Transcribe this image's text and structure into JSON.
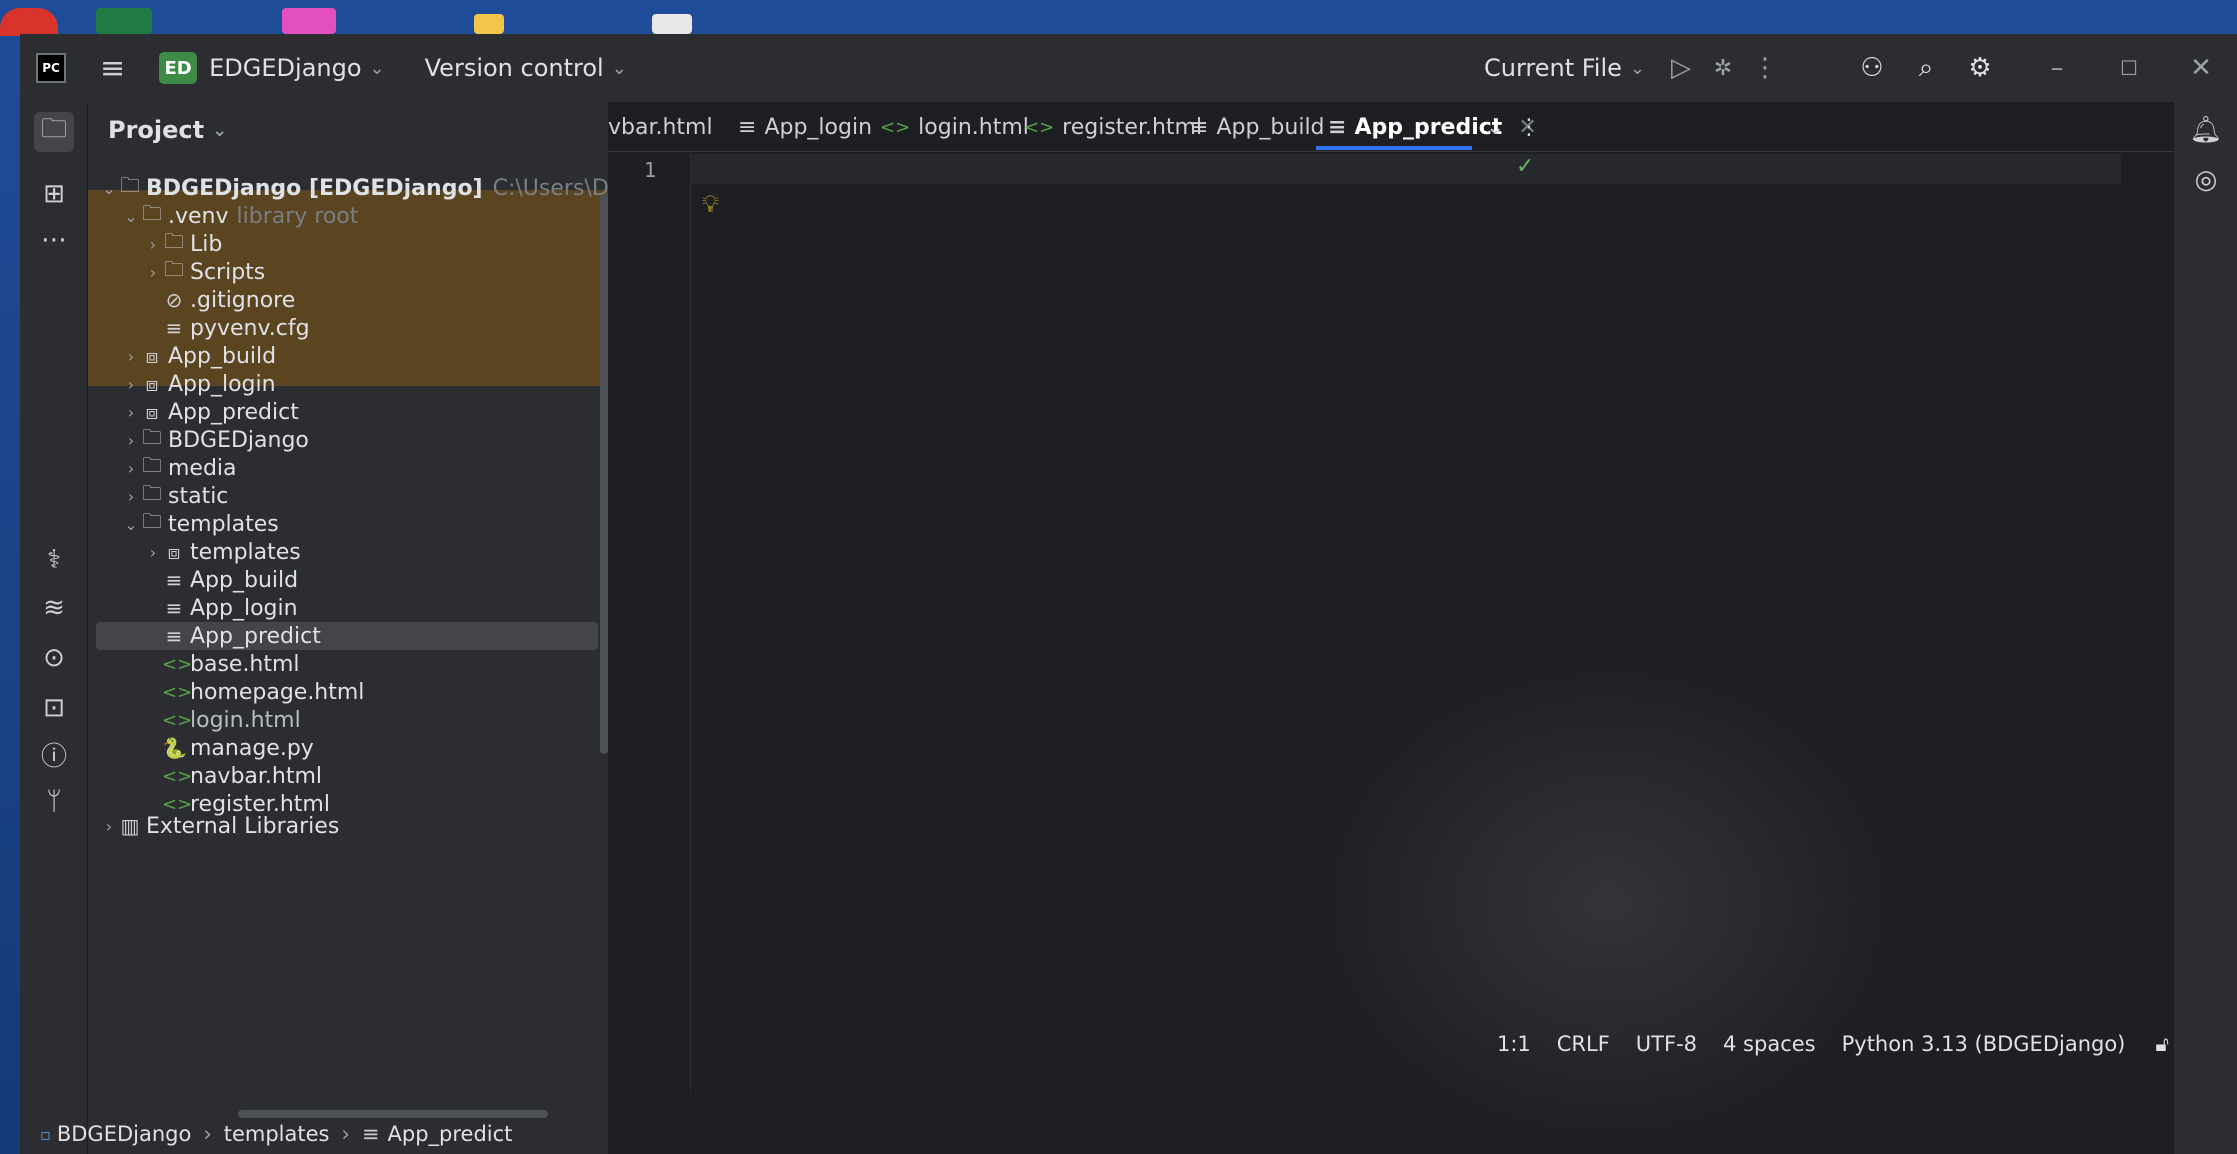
{
  "titlebar": {
    "app_icon": "PC",
    "menu_icon": "hamburger-icon",
    "project_badge": "ED",
    "project_name": "EDGEDjango",
    "vcs": "Version control",
    "run_config": "Current File"
  },
  "toolstrip": {
    "items": [
      "folder-icon",
      "structure-icon",
      "more-icon",
      "python-console-icon",
      "layers-icon",
      "services-icon",
      "terminal-icon",
      "problems-icon",
      "git-icon"
    ]
  },
  "project": {
    "header": "Project",
    "root_name": "BDGEDjango [EDGEDjango]",
    "root_path": "C:\\Users\\Dibakar\\PycharmProject",
    "venv": ".venv",
    "venv_hint": "library root",
    "items": {
      "lib": "Lib",
      "scripts": "Scripts",
      "gitignore": ".gitignore",
      "pyvenv": "pyvenv.cfg",
      "app_build": "App_build",
      "app_login": "App_login",
      "app_predict": "App_predict",
      "bdgedjango": "BDGEDjango",
      "media": "media",
      "static": "static",
      "templates": "templates",
      "templates_sub": "templates",
      "t_app_build": "App_build",
      "t_app_login": "App_login",
      "t_app_predict": "App_predict",
      "base_html": "base.html",
      "homepage_html": "homepage.html",
      "login_html": "login.html",
      "manage_py": "manage.py",
      "navbar_html": "navbar.html",
      "register_html": "register.html",
      "external": "External Libraries"
    }
  },
  "tabs": [
    "vbar.html",
    "App_login",
    "login.html",
    "register.html",
    "App_build",
    "App_predict"
  ],
  "editor": {
    "line1": "1"
  },
  "status": {
    "position": "1:1",
    "line_sep": "CRLF",
    "encoding": "UTF-8",
    "indent": "4 spaces",
    "interpreter": "Python 3.13 (BDGEDjango)"
  },
  "breadcrumb": [
    "BDGEDjango",
    "templates",
    "App_predict"
  ]
}
